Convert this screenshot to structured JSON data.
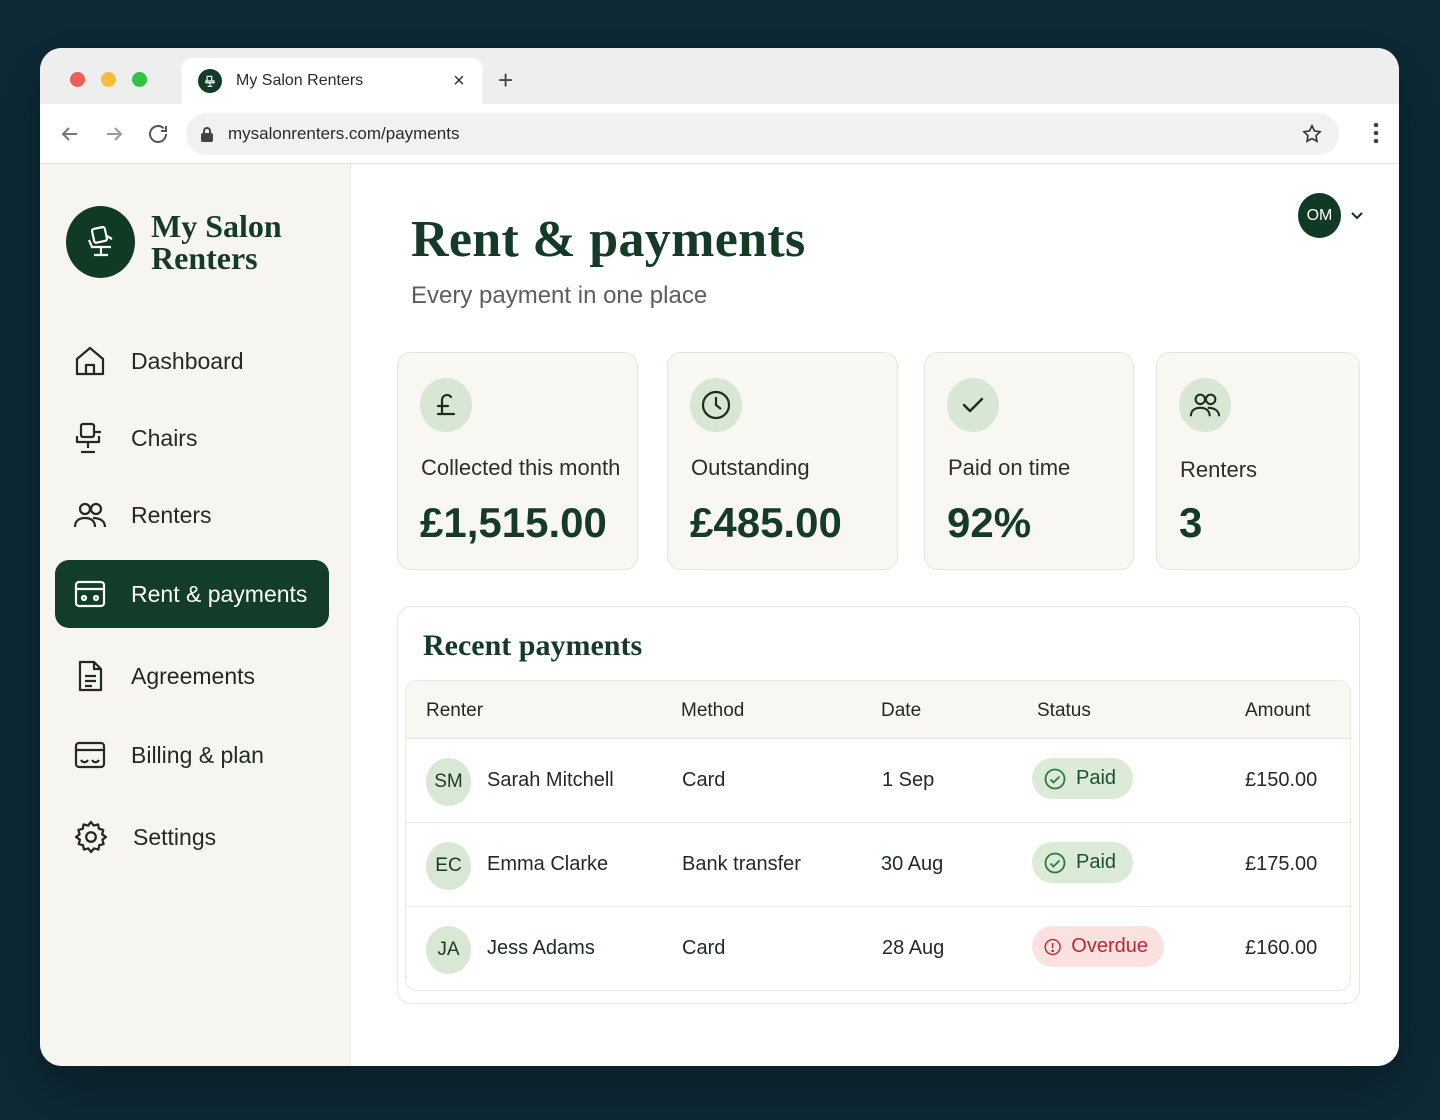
{
  "browser": {
    "tab_title": "My Salon Renters",
    "url": "mysalonrenters.com/payments"
  },
  "brand": {
    "name": "My Salon Renters"
  },
  "sidebar": {
    "items": [
      {
        "label": "Dashboard",
        "icon": "home-icon"
      },
      {
        "label": "Chairs",
        "icon": "salon-chair-icon"
      },
      {
        "label": "Renters",
        "icon": "users-icon"
      },
      {
        "label": "Rent & payments",
        "icon": "payments-icon",
        "active": true
      },
      {
        "label": "Agreements",
        "icon": "document-icon"
      },
      {
        "label": "Billing & plan",
        "icon": "billing-icon"
      },
      {
        "label": "Settings",
        "icon": "gear-icon"
      }
    ]
  },
  "header": {
    "title": "Rent & payments",
    "subtitle": "Every payment in one place",
    "user_initials": "OM"
  },
  "stats": [
    {
      "label": "Collected this month",
      "value": "£1,515.00",
      "icon": "pound-icon"
    },
    {
      "label": "Outstanding",
      "value": "£485.00",
      "icon": "clock-icon"
    },
    {
      "label": "Paid on time",
      "value": "92%",
      "icon": "check-icon"
    },
    {
      "label": "Renters",
      "value": "3",
      "icon": "users-icon"
    }
  ],
  "payments": {
    "title": "Recent payments",
    "columns": [
      "Renter",
      "Method",
      "Date",
      "Status",
      "Amount"
    ],
    "rows": [
      {
        "initials": "SM",
        "renter": "Sarah Mitchell",
        "method": "Card",
        "date": "1 Sep",
        "status": "Paid",
        "amount": "£150.00"
      },
      {
        "initials": "EC",
        "renter": "Emma Clarke",
        "method": "Bank transfer",
        "date": "30 Aug",
        "status": "Paid",
        "amount": "£175.00"
      },
      {
        "initials": "JA",
        "renter": "Jess Adams",
        "method": "Card",
        "date": "28 Aug",
        "status": "Overdue",
        "amount": "£160.00"
      }
    ]
  },
  "colors": {
    "brand_green": "#123d28",
    "accent_light_green": "#d7e7d4",
    "overdue_red": "#c1272d",
    "background": "#0e2a37"
  }
}
